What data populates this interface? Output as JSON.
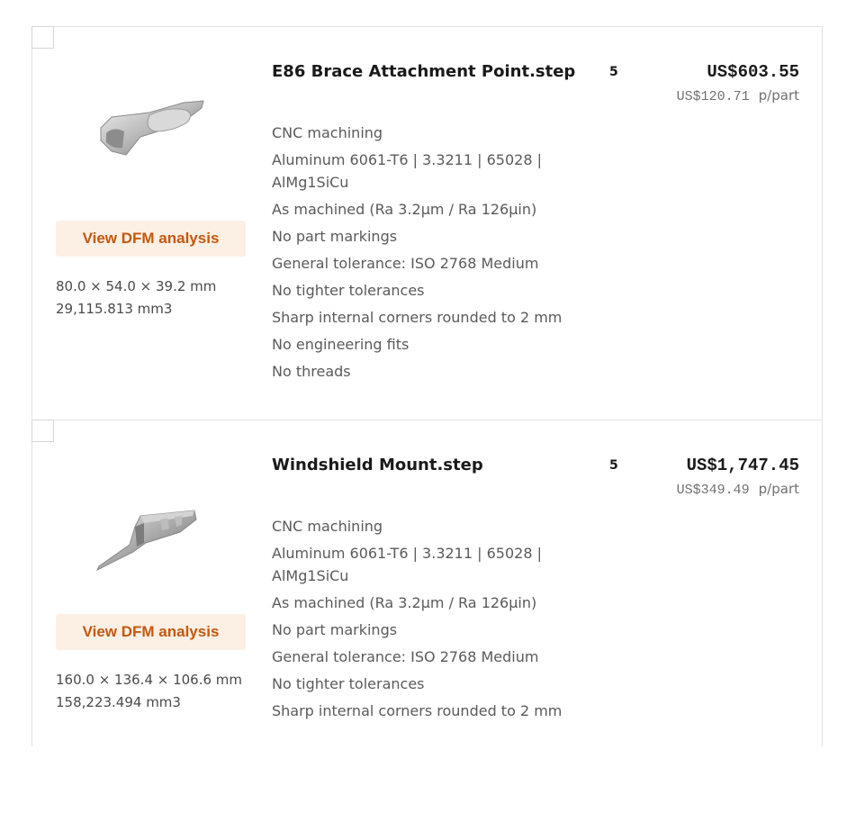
{
  "parts": [
    {
      "name": "E86 Brace Attachment Point.step",
      "quantity": "5",
      "total_price": "US$603.55",
      "unit_price": "US$120.71",
      "unit_suffix": "p/part",
      "dfm_button": "View DFM analysis",
      "dimensions": "80.0 × 54.0 × 39.2 mm",
      "volume": "29,115.813 mm3",
      "thumbnail_icon": "bracket-part-thumbnail-icon",
      "specs": [
        "CNC machining",
        "Aluminum 6061-T6 | 3.3211 | 65028 | AlMg1SiCu",
        "As machined (Ra 3.2μm / Ra 126μin)",
        "No part markings",
        "General tolerance: ISO 2768 Medium",
        "No tighter tolerances",
        "Sharp internal corners rounded to 2 mm",
        "No engineering fits",
        "No threads"
      ]
    },
    {
      "name": "Windshield Mount.step",
      "quantity": "5",
      "total_price": "US$1,747.45",
      "unit_price": "US$349.49",
      "unit_suffix": "p/part",
      "dfm_button": "View DFM analysis",
      "dimensions": "160.0 × 136.4 × 106.6 mm",
      "volume": "158,223.494 mm3",
      "thumbnail_icon": "mount-part-thumbnail-icon",
      "specs": [
        "CNC machining",
        "Aluminum 6061-T6 | 3.3211 | 65028 | AlMg1SiCu",
        "As machined (Ra 3.2μm / Ra 126μin)",
        "No part markings",
        "General tolerance: ISO 2768 Medium",
        "No tighter tolerances",
        "Sharp internal corners rounded to 2 mm"
      ]
    }
  ],
  "colors": {
    "dfm_button_bg": "#fcefe4",
    "dfm_button_text": "#c2580f",
    "border": "#e3e3e3"
  }
}
